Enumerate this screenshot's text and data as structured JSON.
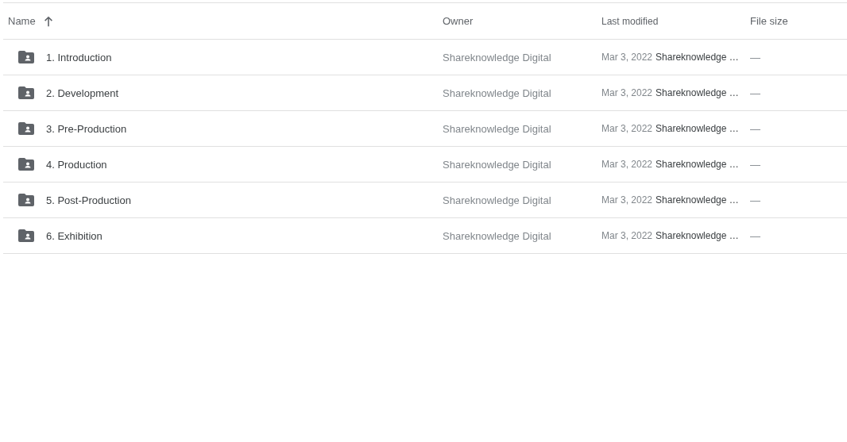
{
  "table": {
    "columns": [
      {
        "label": "Name",
        "sorted": true
      },
      {
        "label": "Owner"
      },
      {
        "label": "Last modified"
      },
      {
        "label": "File size"
      }
    ],
    "rows": [
      {
        "name": "1. Introduction",
        "owner": "Shareknowledge Digital",
        "date": "Mar 3, 2022",
        "modified_by": "Shareknowledge …",
        "size": "—"
      },
      {
        "name": "2. Development",
        "owner": "Shareknowledge Digital",
        "date": "Mar 3, 2022",
        "modified_by": "Shareknowledge …",
        "size": "—"
      },
      {
        "name": "3. Pre-Production",
        "owner": "Shareknowledge Digital",
        "date": "Mar 3, 2022",
        "modified_by": "Shareknowledge …",
        "size": "—"
      },
      {
        "name": "4. Production",
        "owner": "Shareknowledge Digital",
        "date": "Mar 3, 2022",
        "modified_by": "Shareknowledge …",
        "size": "—"
      },
      {
        "name": "5. Post-Production",
        "owner": "Shareknowledge Digital",
        "date": "Mar 3, 2022",
        "modified_by": "Shareknowledge …",
        "size": "—"
      },
      {
        "name": "6. Exhibition",
        "owner": "Shareknowledge Digital",
        "date": "Mar 3, 2022",
        "modified_by": "Shareknowledge …",
        "size": "—"
      }
    ]
  }
}
